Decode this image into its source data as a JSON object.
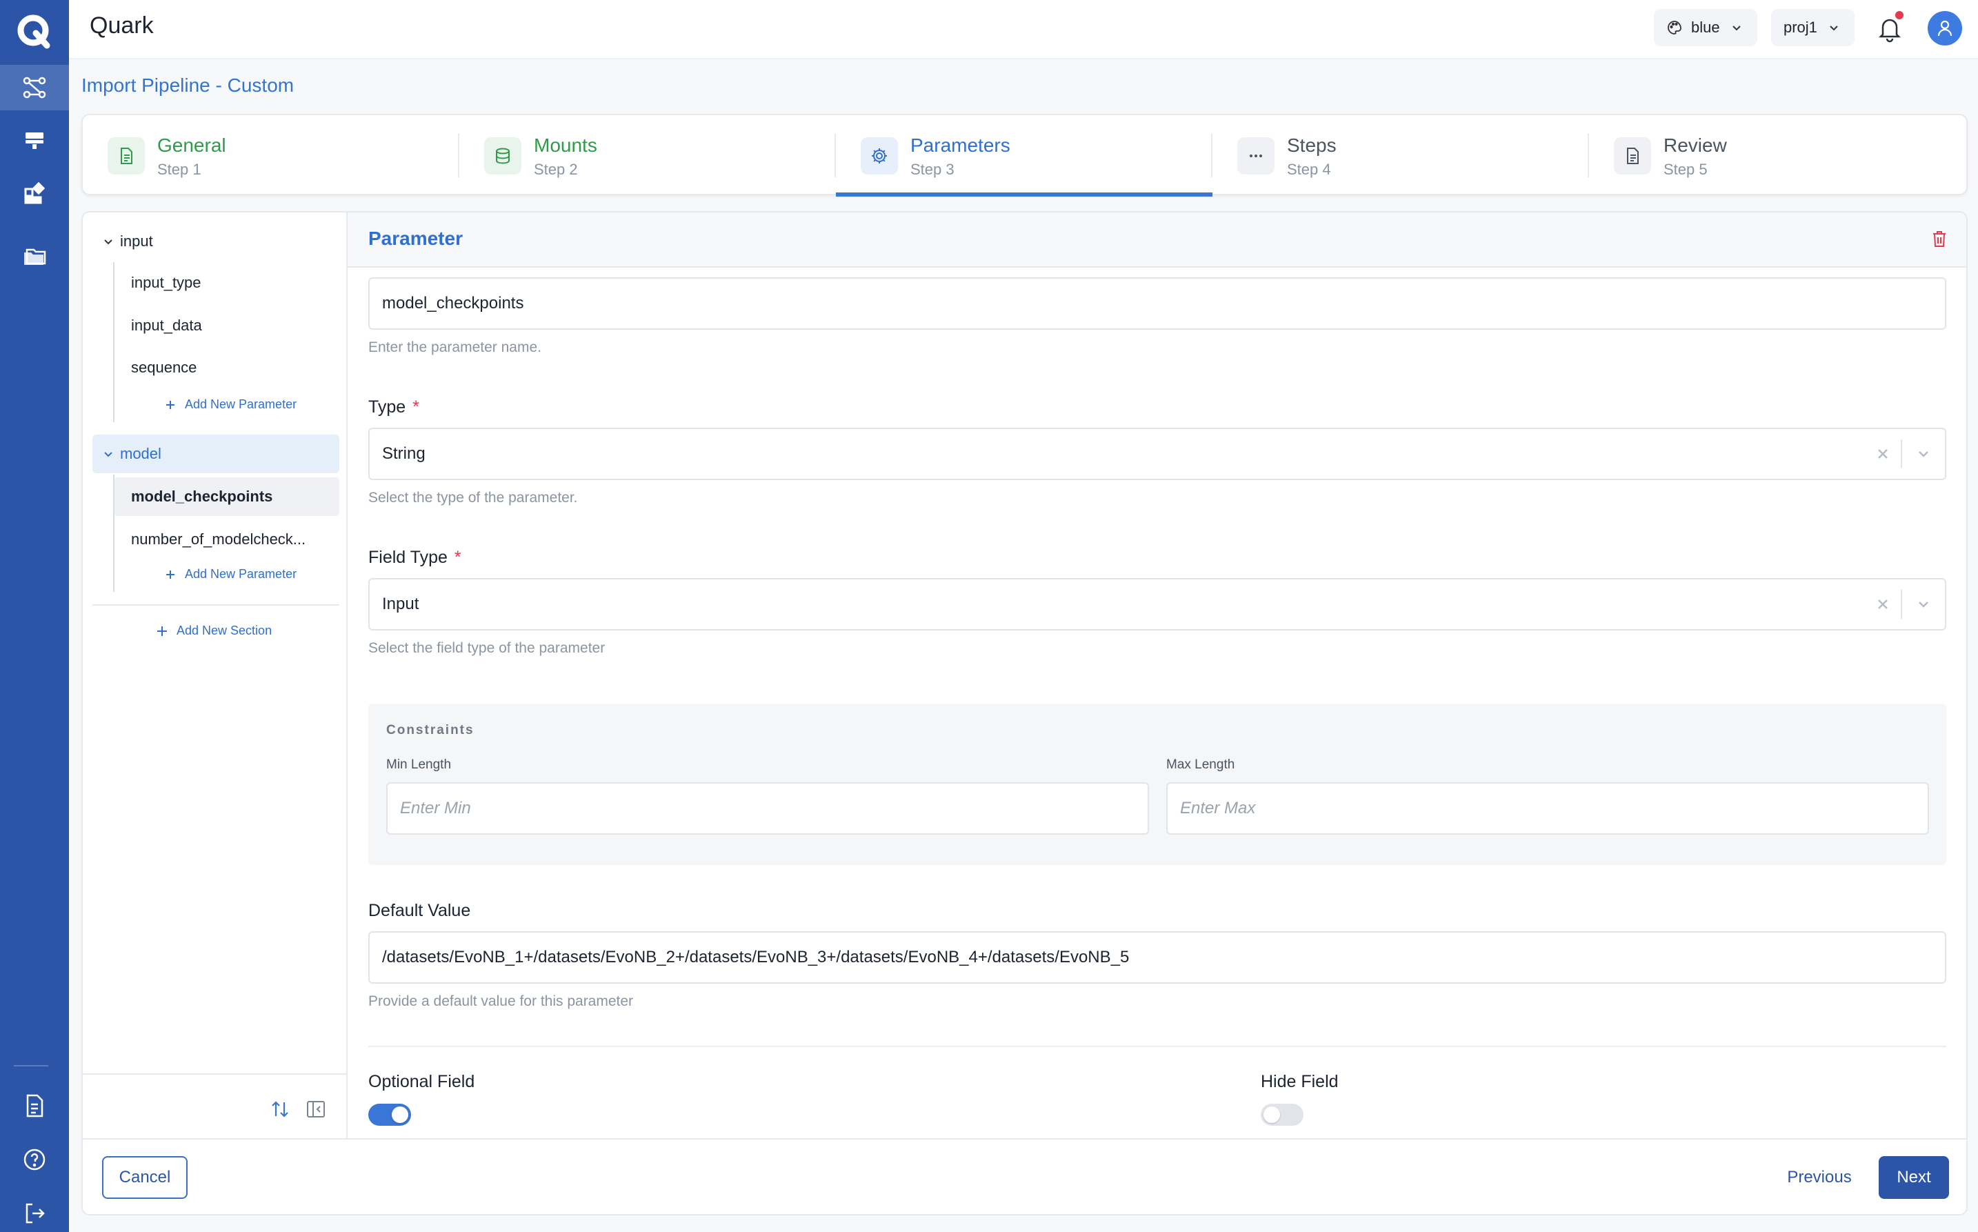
{
  "app": {
    "title": "Quark"
  },
  "header": {
    "theme_label": "blue",
    "project_label": "proj1"
  },
  "page": {
    "title": "Import Pipeline - Custom"
  },
  "steps": [
    {
      "title": "General",
      "sub": "Step 1",
      "state": "done",
      "icon": "document-icon"
    },
    {
      "title": "Mounts",
      "sub": "Step 2",
      "state": "done",
      "icon": "database-icon"
    },
    {
      "title": "Parameters",
      "sub": "Step 3",
      "state": "active",
      "icon": "gear-icon"
    },
    {
      "title": "Steps",
      "sub": "Step 4",
      "state": "todo",
      "icon": "ellipsis-icon"
    },
    {
      "title": "Review",
      "sub": "Step 5",
      "state": "todo",
      "icon": "document-icon"
    }
  ],
  "tree": {
    "sections": [
      {
        "name": "input",
        "params": [
          "input_type",
          "input_data",
          "sequence"
        ]
      },
      {
        "name": "model",
        "params": [
          "model_checkpoints",
          "number_of_modelcheck..."
        ]
      }
    ],
    "add_param_label": "Add New Parameter",
    "add_section_label": "Add New Section"
  },
  "form": {
    "header": "Parameter",
    "name_value": "model_checkpoints",
    "name_help": "Enter the parameter name.",
    "type_label": "Type",
    "type_value": "String",
    "type_help": "Select the type of the parameter.",
    "field_type_label": "Field Type",
    "field_type_value": "Input",
    "field_type_help": "Select the field type of the parameter",
    "constraints_title": "Constraints",
    "min_label": "Min Length",
    "min_placeholder": "Enter Min",
    "max_label": "Max Length",
    "max_placeholder": "Enter Max",
    "default_label": "Default Value",
    "default_value": "/datasets/EvoNB_1+/datasets/EvoNB_2+/datasets/EvoNB_3+/datasets/EvoNB_4+/datasets/EvoNB_5",
    "default_help": "Provide a default value for this parameter",
    "optional_label": "Optional Field",
    "optional_on": true,
    "hide_label": "Hide Field",
    "hide_on": false
  },
  "footer": {
    "cancel": "Cancel",
    "previous": "Previous",
    "next": "Next"
  },
  "colors": {
    "brand": "#2c55a8",
    "accent": "#3a76d6",
    "success": "#2f9a48",
    "danger": "#e53950"
  }
}
